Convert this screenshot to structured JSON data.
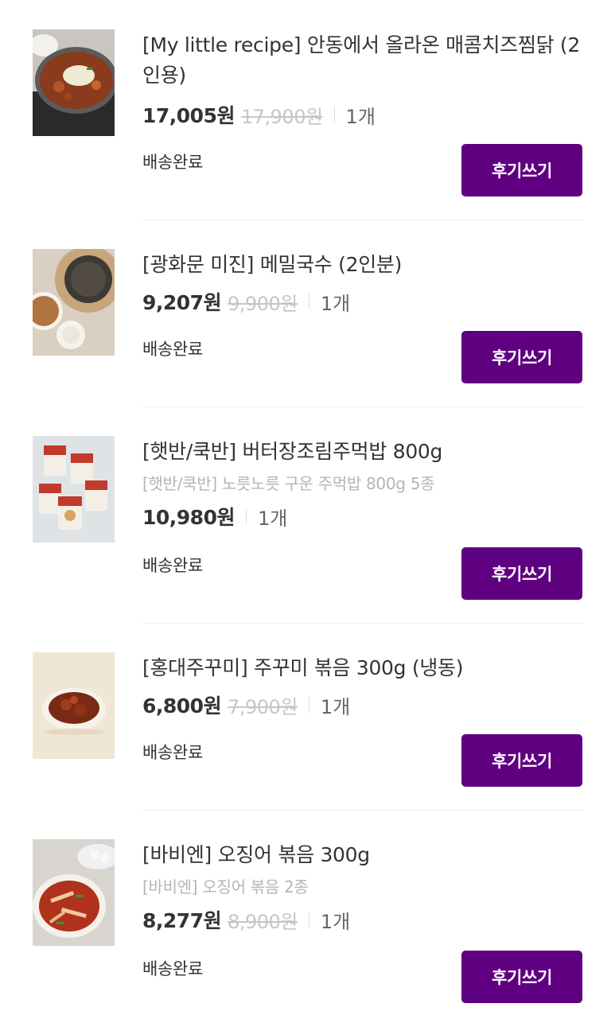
{
  "orders": [
    {
      "title": "[My little recipe] 안동에서 올라온 매콤치즈찜닭 (2인용)",
      "subtitle": "",
      "price": "17,005원",
      "original_price": "17,900원",
      "quantity": "1개",
      "status": "배송완료",
      "review_label": "후기쓰기"
    },
    {
      "title": "[광화문 미진] 메밀국수 (2인분)",
      "subtitle": "",
      "price": "9,207원",
      "original_price": "9,900원",
      "quantity": "1개",
      "status": "배송완료",
      "review_label": "후기쓰기"
    },
    {
      "title": "[햇반/쿡반] 버터장조림주먹밥 800g",
      "subtitle": "[햇반/쿡반] 노릇노릇 구운 주먹밥 800g 5종",
      "price": "10,980원",
      "original_price": "",
      "quantity": "1개",
      "status": "배송완료",
      "review_label": "후기쓰기"
    },
    {
      "title": "[홍대주꾸미] 주꾸미 볶음 300g (냉동)",
      "subtitle": "",
      "price": "6,800원",
      "original_price": "7,900원",
      "quantity": "1개",
      "status": "배송완료",
      "review_label": "후기쓰기"
    },
    {
      "title": "[바비엔] 오징어 볶음 300g",
      "subtitle": "[바비엔] 오징어 볶음 2종",
      "price": "8,277원",
      "original_price": "8,900원",
      "quantity": "1개",
      "status": "배송완료",
      "review_label": "후기쓰기"
    }
  ],
  "images": [
    "product-image-braised-chicken",
    "product-image-buckwheat-noodles",
    "product-image-rice-ball-packages",
    "product-image-spicy-webfoot-octopus",
    "product-image-stir-fried-squid"
  ],
  "colors": {
    "accent": "#5f0080",
    "text": "#333333",
    "muted": "#b5b5b5",
    "strike": "#c6c6c6"
  }
}
